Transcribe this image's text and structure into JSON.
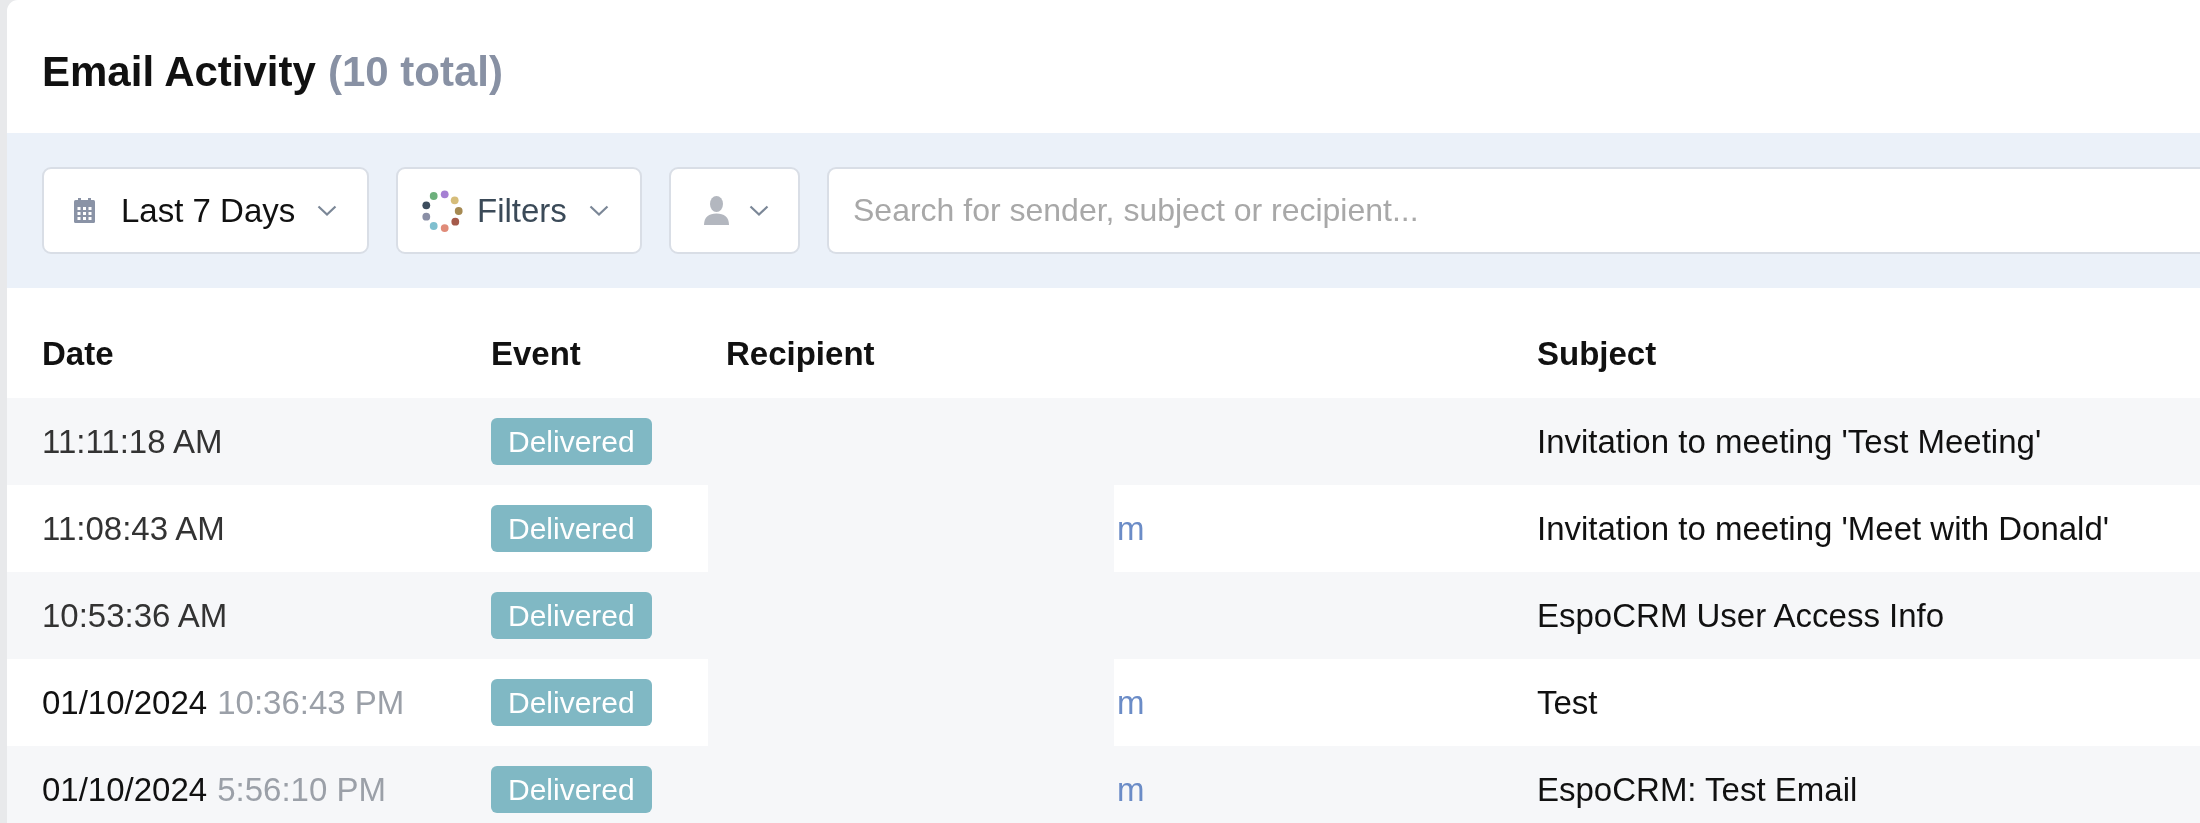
{
  "panel": {
    "title": "Email Activity",
    "count": "(10 total)"
  },
  "toolbar": {
    "buttons": [
      {
        "kind": "date",
        "label": "Last 7 Days"
      },
      {
        "kind": "filters",
        "label": "Filters"
      },
      {
        "kind": "user"
      }
    ],
    "search": {
      "placeholder": "Search for sender, subject or recipient..."
    }
  },
  "table": {
    "columns": [
      "Date",
      "Event",
      "Recipient",
      "Subject"
    ],
    "rows": [
      {
        "time": "11:11:18 AM",
        "event": "Delivered",
        "subject": "Invitation to meeting 'Test Meeting'"
      },
      {
        "time": "11:08:43 AM",
        "event": "Delivered",
        "recipient": "m",
        "subject": "Invitation to meeting 'Meet with Donald'"
      },
      {
        "time": "10:53:36 AM",
        "event": "Delivered",
        "subject": "EspoCRM User Access Info"
      },
      {
        "date": "01/10/2024",
        "time": "10:36:43 PM",
        "event": "Delivered",
        "recipient": "m",
        "subject": "Test"
      },
      {
        "date": "01/10/2024",
        "time": "5:56:10 PM",
        "event": "Delivered",
        "recipient": "m",
        "subject": "EspoCRM: Test Email"
      }
    ]
  }
}
